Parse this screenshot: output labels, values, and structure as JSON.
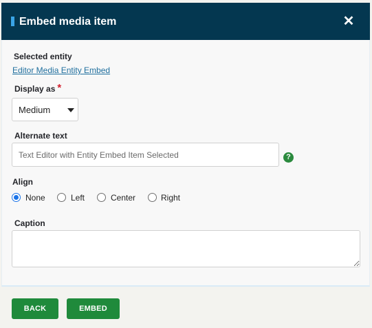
{
  "dialog": {
    "title": "Embed media item",
    "close_glyph": "✕",
    "close_icon": "close-icon"
  },
  "selected_entity": {
    "label": "Selected entity",
    "link_text": "Editor Media Entity Embed"
  },
  "display_as": {
    "label": "Display as",
    "required_mark": "*",
    "selected_value": "Medium"
  },
  "alternate_text": {
    "label": "Alternate text",
    "placeholder": "Text Editor with Entity Embed Item Selected",
    "value": "",
    "help_glyph": "?"
  },
  "align": {
    "label": "Align",
    "options": [
      {
        "label": "None",
        "checked": true
      },
      {
        "label": "Left",
        "checked": false
      },
      {
        "label": "Center",
        "checked": false
      },
      {
        "label": "Right",
        "checked": false
      }
    ]
  },
  "caption": {
    "label": "Caption",
    "value": ""
  },
  "buttons": {
    "back": "BACK",
    "embed": "EMBED"
  },
  "colors": {
    "header_bg": "#043750",
    "header_accent": "#3aa4e6",
    "primary_button": "#1f8a3b",
    "link": "#1f6f9e",
    "required": "#d3212f",
    "radio_checked": "#1a73e8"
  }
}
